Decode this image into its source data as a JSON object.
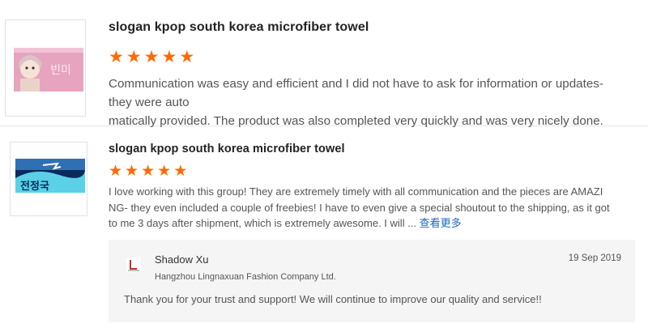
{
  "reviews": [
    {
      "product_title": "slogan kpop south korea microfiber towel",
      "rating": 5,
      "stars": [
        "★",
        "★",
        "★",
        "★",
        "★"
      ],
      "text_lines": [
        "Communication was easy and efficient and I did not have to ask for information or updates- they were auto",
        "matically provided. The product was also completed very quickly and was very nicely done."
      ],
      "thumbnail": {
        "text": "빈미",
        "bg_color": "#e7a4bf"
      }
    },
    {
      "product_title": "slogan kpop south korea microfiber towel",
      "rating": 5,
      "stars": [
        "★",
        "★",
        "★",
        "★",
        "★"
      ],
      "text_lines": [
        "I love working with this group! They are extremely timely with all communication and the pieces are AMAZI",
        "NG- they even included a couple of freebies! I have to even give a special shoutout to the shipping, as it got",
        "to me 3 days after shipment, which is extremely awesome. I will ..."
      ],
      "more_link": "查看更多",
      "thumbnail": {
        "text": "전정국",
        "bg_color": "#0b2a5c"
      },
      "reply": {
        "seller_name": "Shadow Xu",
        "company": "Hangzhou Lingnaxuan Fashion Company Ltd.",
        "date": "19 Sep 2019",
        "text": "Thank you for your trust and support! We will continue to improve our quality and service!!"
      }
    }
  ],
  "colors": {
    "star": "#ff6a00",
    "link": "#1a66c2",
    "reply_bg": "#f5f5f5"
  }
}
